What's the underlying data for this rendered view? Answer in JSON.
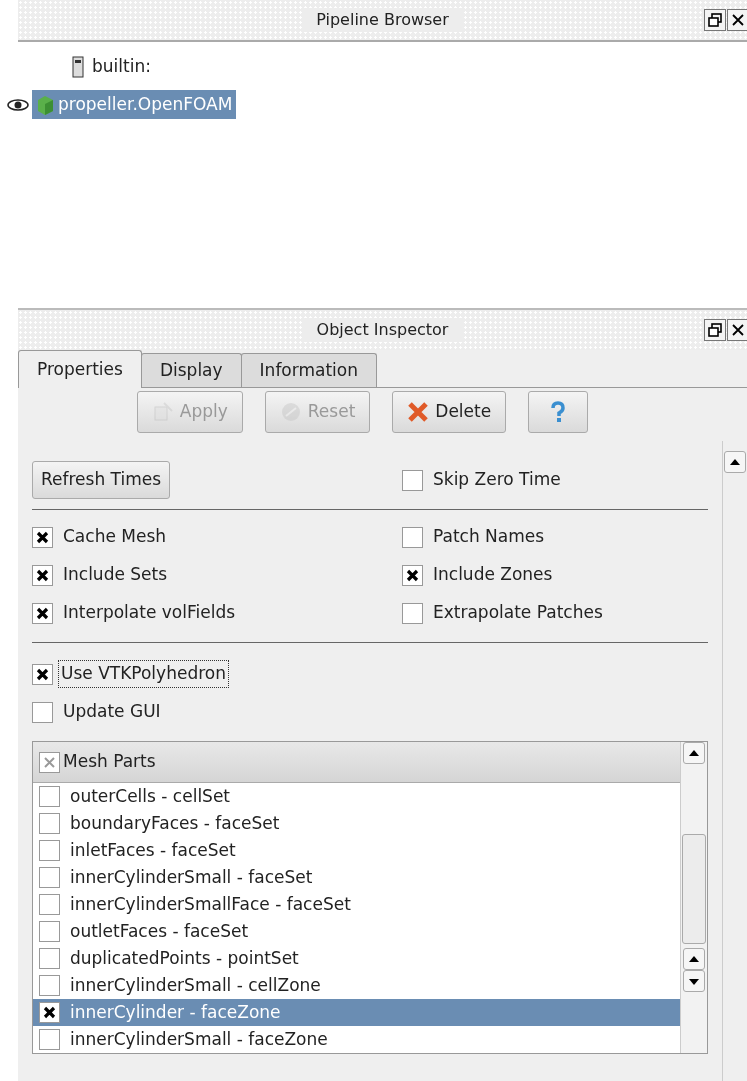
{
  "pipeline_browser": {
    "title": "Pipeline Browser",
    "items": [
      {
        "label": "builtin:",
        "kind": "server",
        "selected": false,
        "visible": false
      },
      {
        "label": "propeller.OpenFOAM",
        "kind": "reader",
        "selected": true,
        "visible": true
      }
    ]
  },
  "object_inspector": {
    "title": "Object Inspector",
    "tabs": [
      {
        "label": "Properties",
        "selected": true
      },
      {
        "label": "Display",
        "selected": false
      },
      {
        "label": "Information",
        "selected": false
      }
    ],
    "buttons": [
      {
        "label": "Apply",
        "kind": "apply",
        "disabled": true
      },
      {
        "label": "Reset",
        "kind": "reset",
        "disabled": true
      },
      {
        "label": "Delete",
        "kind": "delete",
        "disabled": false
      },
      {
        "kind": "help",
        "disabled": false
      }
    ],
    "refresh_button": "Refresh Times",
    "skip_zero_time": {
      "label": "Skip Zero Time",
      "checked": false
    },
    "options": [
      {
        "label": "Cache Mesh",
        "checked": true
      },
      {
        "label": "Patch Names",
        "checked": false
      },
      {
        "label": "Include Sets",
        "checked": true
      },
      {
        "label": "Include Zones",
        "checked": true
      },
      {
        "label": "Interpolate volFields",
        "checked": true
      },
      {
        "label": "Extrapolate Patches",
        "checked": false
      }
    ],
    "extra_options": [
      {
        "label": "Use VTKPolyhedron",
        "checked": true,
        "focused": true
      },
      {
        "label": "Update GUI",
        "checked": false,
        "focused": false
      }
    ],
    "mesh_parts": {
      "header": "Mesh Parts",
      "header_partially_checked": true,
      "items": [
        {
          "label": "outerCells - cellSet",
          "checked": false,
          "selected": false
        },
        {
          "label": "boundaryFaces - faceSet",
          "checked": false,
          "selected": false
        },
        {
          "label": "inletFaces - faceSet",
          "checked": false,
          "selected": false
        },
        {
          "label": "innerCylinderSmall - faceSet",
          "checked": false,
          "selected": false
        },
        {
          "label": "innerCylinderSmallFace - faceSet",
          "checked": false,
          "selected": false
        },
        {
          "label": "outletFaces - faceSet",
          "checked": false,
          "selected": false
        },
        {
          "label": "duplicatedPoints - pointSet",
          "checked": false,
          "selected": false
        },
        {
          "label": "innerCylinderSmall - cellZone",
          "checked": false,
          "selected": false
        },
        {
          "label": "innerCylinder - faceZone",
          "checked": true,
          "selected": true
        },
        {
          "label": "innerCylinderSmall - faceZone",
          "checked": false,
          "selected": false
        }
      ]
    }
  }
}
